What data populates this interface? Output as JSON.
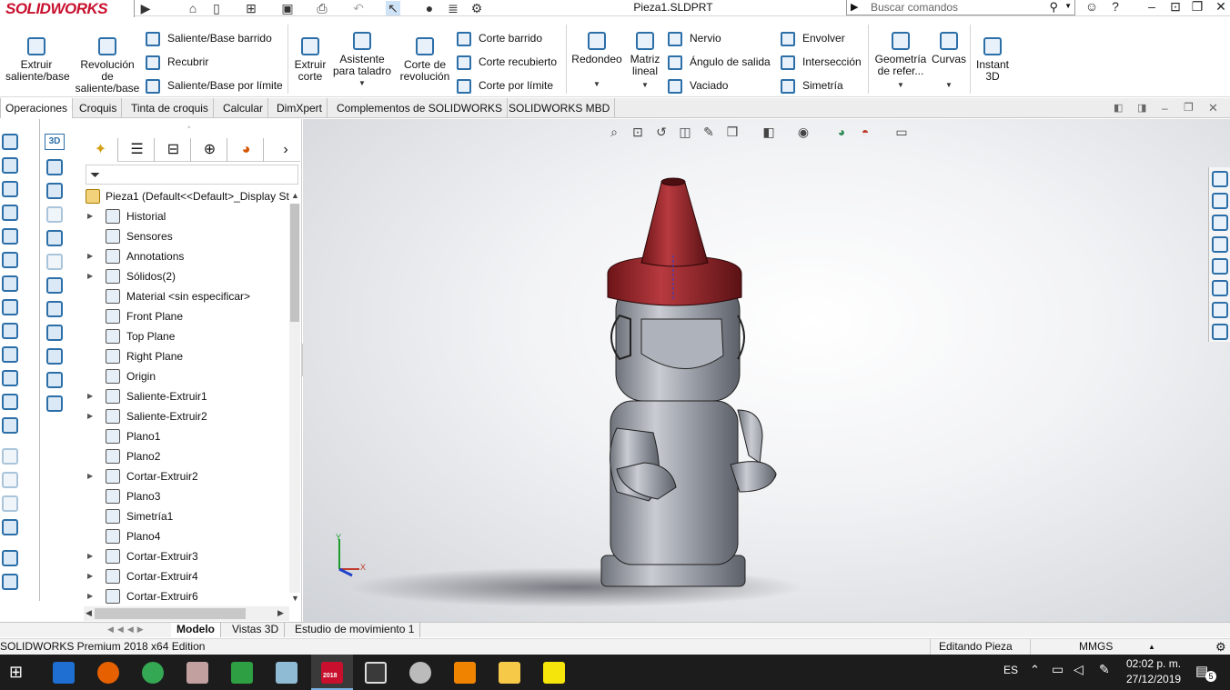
{
  "app": {
    "logo": "SOLIDWORKS",
    "document_title": "Pieza1.SLDPRT",
    "search_placeholder": "Buscar comandos"
  },
  "ribbon": {
    "extrude_boss": "Extruir saliente/base",
    "revolve_boss": "Revolución de saliente/base",
    "swept_boss": "Saliente/Base barrido",
    "loft_boss": "Recubrir",
    "boundary_boss": "Saliente/Base por límite",
    "extrude_cut": "Extruir corte",
    "hole_wizard": "Asistente para taladro",
    "revolve_cut": "Corte de revolución",
    "swept_cut": "Corte barrido",
    "loft_cut": "Corte recubierto",
    "boundary_cut": "Corte por límite",
    "fillet": "Redondeo",
    "linear_pattern": "Matriz lineal",
    "rib": "Nervio",
    "draft": "Ángulo de salida",
    "shell": "Vaciado",
    "wrap": "Envolver",
    "intersect": "Intersección",
    "mirror": "Simetría",
    "ref_geometry": "Geometría de refer...",
    "curves": "Curvas",
    "instant3d": "Instant 3D"
  },
  "tabs": [
    "Operaciones",
    "Croquis",
    "Tinta de croquis",
    "Calcular",
    "DimXpert",
    "Complementos de SOLIDWORKS",
    "SOLIDWORKS MBD"
  ],
  "tree": {
    "root": "Pieza1  (Default<<Default>_Display St",
    "items": [
      {
        "label": "Historial",
        "expandable": true
      },
      {
        "label": "Sensores",
        "expandable": false
      },
      {
        "label": "Annotations",
        "expandable": true
      },
      {
        "label": "Sólidos(2)",
        "expandable": true
      },
      {
        "label": "Material <sin especificar>",
        "expandable": false
      },
      {
        "label": "Front Plane",
        "expandable": false
      },
      {
        "label": "Top Plane",
        "expandable": false
      },
      {
        "label": "Right Plane",
        "expandable": false
      },
      {
        "label": "Origin",
        "expandable": false
      },
      {
        "label": "Saliente-Extruir1",
        "expandable": true
      },
      {
        "label": "Saliente-Extruir2",
        "expandable": true
      },
      {
        "label": "Plano1",
        "expandable": false
      },
      {
        "label": "Plano2",
        "expandable": false
      },
      {
        "label": "Cortar-Extruir2",
        "expandable": true
      },
      {
        "label": "Plano3",
        "expandable": false
      },
      {
        "label": "Simetría1",
        "expandable": false
      },
      {
        "label": "Plano4",
        "expandable": false
      },
      {
        "label": "Cortar-Extruir3",
        "expandable": true
      },
      {
        "label": "Cortar-Extruir4",
        "expandable": true
      },
      {
        "label": "Cortar-Extruir6",
        "expandable": true
      }
    ]
  },
  "triad": {
    "y": "Y",
    "x": "X"
  },
  "bottom_tabs": [
    "Modelo",
    "Vistas 3D",
    "Estudio de movimiento 1"
  ],
  "status": {
    "edition": "SOLIDWORKS Premium 2018 x64 Edition",
    "mode": "Editando Pieza",
    "units": "MMGS"
  },
  "taskbar": {
    "lang": "ES",
    "time": "02:02 p. m.",
    "date": "27/12/2019",
    "notifications": "5",
    "sw_badge": "2018"
  },
  "colors": {
    "accent": "#2c6fa8",
    "brand_red": "#c8102e",
    "cap_red": "#8e2024",
    "body_grey": "#9fa4ad"
  }
}
